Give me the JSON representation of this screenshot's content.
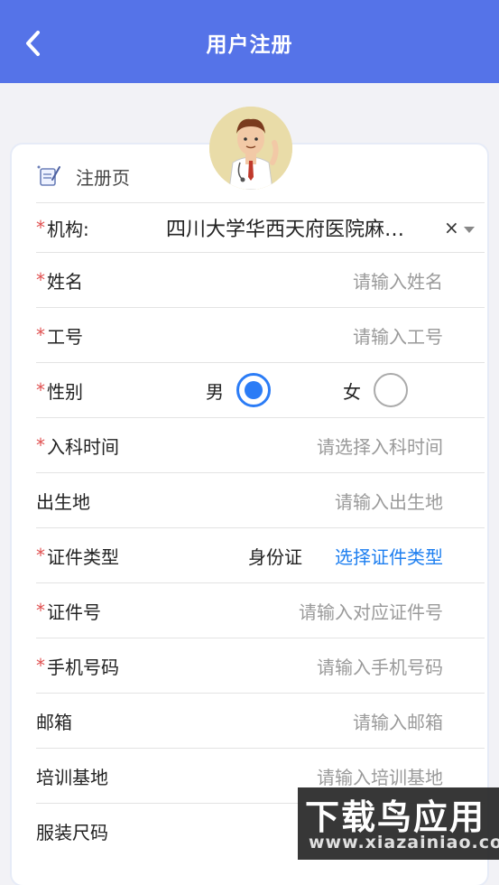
{
  "header": {
    "title": "用户注册",
    "back_icon": "chevron-left-icon"
  },
  "card": {
    "heading": "注册页",
    "heading_icon": "scroll-pen-icon"
  },
  "form": {
    "required_mark": "*",
    "institution": {
      "label": "机构:",
      "value": "四川大学华西天府医院麻…",
      "clear": "×"
    },
    "name": {
      "label": "姓名",
      "placeholder": "请输入姓名"
    },
    "employee_id": {
      "label": "工号",
      "placeholder": "请输入工号"
    },
    "gender": {
      "label": "性别",
      "male": "男",
      "female": "女",
      "selected": "男"
    },
    "join_date": {
      "label": "入科时间",
      "placeholder": "请选择入科时间"
    },
    "birthplace": {
      "label": "出生地",
      "placeholder": "请输入出生地"
    },
    "id_type": {
      "label": "证件类型",
      "value": "身份证",
      "action": "选择证件类型"
    },
    "id_number": {
      "label": "证件号",
      "placeholder": "请输入对应证件号"
    },
    "phone": {
      "label": "手机号码",
      "placeholder": "请输入手机号码"
    },
    "email": {
      "label": "邮箱",
      "placeholder": "请输入邮箱"
    },
    "training_base": {
      "label": "培训基地",
      "placeholder": "请输入培训基地"
    },
    "uniform_size": {
      "label": "服装尺码"
    }
  },
  "watermark": {
    "top": "下载鸟应用",
    "bottom": "www.xiazainiao.com"
  },
  "colors": {
    "header": "#5573e8",
    "accent": "#2b7cf6",
    "link": "#1e7ff0",
    "required": "#e05050"
  }
}
